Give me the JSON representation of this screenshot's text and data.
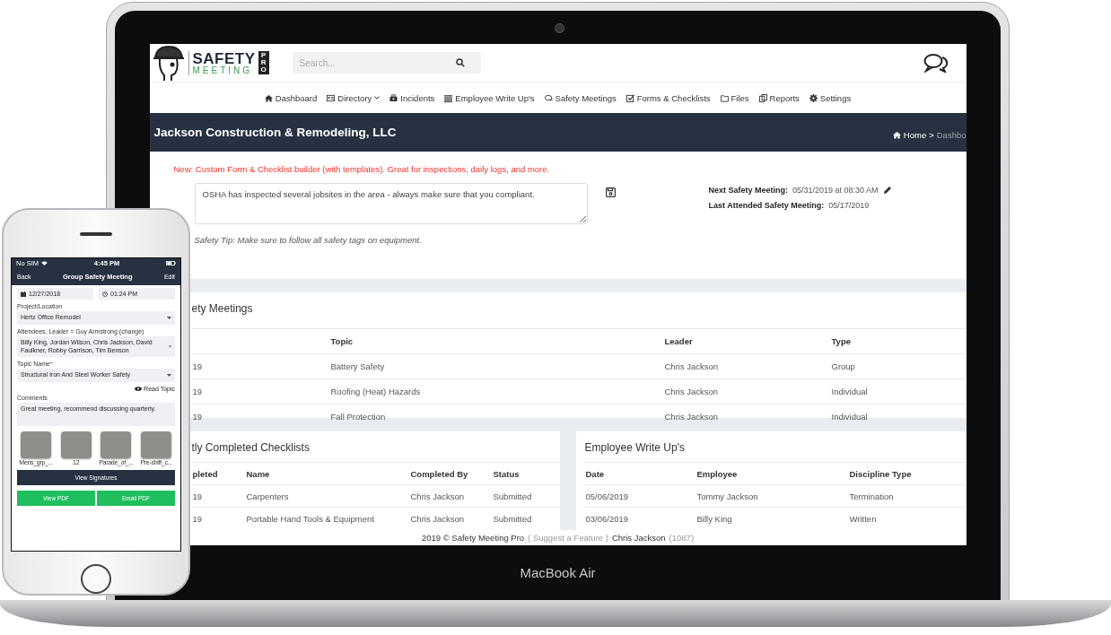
{
  "laptop": {
    "label": "MacBook Air"
  },
  "app": {
    "logo": {
      "line1": "SAFETY",
      "line2": "MEETING",
      "badge": "PRO"
    },
    "search": {
      "placeholder": "Search..."
    },
    "nav": [
      {
        "label": "Dashboard",
        "kind": "home",
        "dropdown": false
      },
      {
        "label": "Directory",
        "kind": "card",
        "dropdown": true
      },
      {
        "label": "Incidents",
        "kind": "case",
        "dropdown": false
      },
      {
        "label": "Employee Write Up's",
        "kind": "list",
        "dropdown": false
      },
      {
        "label": "Safety Meetings",
        "kind": "chat",
        "dropdown": false
      },
      {
        "label": "Forms & Checklists",
        "kind": "check",
        "dropdown": false
      },
      {
        "label": "Files",
        "kind": "folder",
        "dropdown": false
      },
      {
        "label": "Reports",
        "kind": "copy",
        "dropdown": false
      },
      {
        "label": "Settings",
        "kind": "gear",
        "dropdown": false
      }
    ],
    "company": "Jackson Construction & Remodeling, LLC",
    "breadcrumb": {
      "home": "Home",
      "separator": ">",
      "current": "Dashbo"
    },
    "notice": "New: Custom Form & Checklist builder (with templates). Great for inspections, daily logs, and more.",
    "note": {
      "value": "OSHA has inspected several jobsites in the area - always make sure that you compliant."
    },
    "next_meeting": {
      "label": "Next Safety Meeting:",
      "value": "05/31/2019 at 08:30 AM"
    },
    "last_meeting": {
      "label": "Last Attended Safety Meeting:",
      "value": "05/17/2019"
    },
    "safety_tip": "Safety Tip: Make sure to follow all safety tags on equipment.",
    "meetings": {
      "title": "ety Meetings",
      "columns": [
        "",
        "Topic",
        "Leader",
        "Type"
      ],
      "rows": [
        [
          "19",
          "Battery Safety",
          "Chris Jackson",
          "Group"
        ],
        [
          "19",
          "Roofing (Heat) Hazards",
          "Chris Jackson",
          "Individual"
        ],
        [
          "19",
          "Fall Protection",
          "Chris Jackson",
          "Individual"
        ]
      ]
    },
    "checklists": {
      "title": "tly Completed Checklists",
      "columns": [
        "pleted",
        "Name",
        "Completed By",
        "Status"
      ],
      "rows": [
        [
          "19",
          "Carpenters",
          "Chris Jackson",
          "Submitted"
        ],
        [
          "19",
          "Portable Hand Tools & Equipment",
          "Chris Jackson",
          "Submitted"
        ]
      ]
    },
    "writeups": {
      "title": "Employee Write Up's",
      "columns": [
        "Date",
        "Employee",
        "Discipline Type"
      ],
      "rows": [
        [
          "05/06/2019",
          "Tommy Jackson",
          "Termination"
        ],
        [
          "03/06/2019",
          "Billy King",
          "Written"
        ]
      ]
    },
    "footer": [
      {
        "text": "2019 © Safety Meeting Pro",
        "muted": false
      },
      {
        "text": "( Suggest a Feature )",
        "muted": true
      },
      {
        "text": "Chris Jackson",
        "muted": false
      },
      {
        "text": "(1087)",
        "muted": true
      }
    ]
  },
  "phone": {
    "status": {
      "carrier": "No SIM",
      "time": "4:45 PM"
    },
    "nav": {
      "back": "Back",
      "title": "Group Safety Meeting",
      "edit": "Edit"
    },
    "date": "12/27/2018",
    "time": "01:24 PM",
    "fields": [
      {
        "label": "Project/Location",
        "value": "Hertz Office Remodel"
      },
      {
        "label": "Attendees, Leader = Guy Armstrong (change)",
        "value": "Billy King, Jordan Wilson, Chris Jackson, David Faulkner, Robby Garrison, Tim Benson"
      },
      {
        "label": "Topic Name",
        "required_mark": "*",
        "value": "Structural Iron And Steel Worker Safety"
      }
    ],
    "read_topic": "Read Topic",
    "comments": {
      "label": "Comments",
      "value": "Great meeting, recommend discussing quarterly."
    },
    "photos": [
      {
        "caption": "Mens_grp_..."
      },
      {
        "caption": "12"
      },
      {
        "caption": "Parade_of_..."
      },
      {
        "caption": "Pre-shift_c..."
      }
    ],
    "signatures_button": "View Signatures",
    "pdf_buttons": [
      "View PDF",
      "Email PDF"
    ]
  }
}
